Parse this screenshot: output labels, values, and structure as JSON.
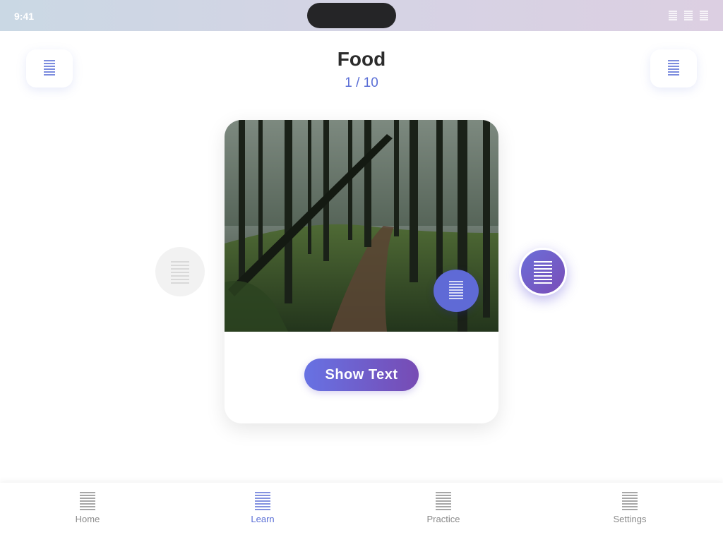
{
  "status_bar": {
    "time": "9:41",
    "icons": [
      "signal-icon",
      "wifi-icon",
      "battery-icon"
    ]
  },
  "header": {
    "title": "Food",
    "progress": "1 / 10",
    "left_button_icon": "menu-icon",
    "right_button_icon": "menu-icon"
  },
  "card": {
    "image": "forest-path-photo",
    "audio_icon": "audio-icon",
    "show_text_label": "Show Text"
  },
  "navigation": {
    "prev_icon": "previous-icon",
    "next_icon": "next-icon"
  },
  "tabs": [
    {
      "label": "Home",
      "icon": "home-icon",
      "active": false
    },
    {
      "label": "Learn",
      "icon": "learn-icon",
      "active": true
    },
    {
      "label": "Practice",
      "icon": "practice-icon",
      "active": false
    },
    {
      "label": "Settings",
      "icon": "settings-icon",
      "active": false
    }
  ],
  "colors": {
    "accent": "#5b6fd6",
    "accent_purple": "#774bb4",
    "inactive": "#8a8a8a"
  }
}
